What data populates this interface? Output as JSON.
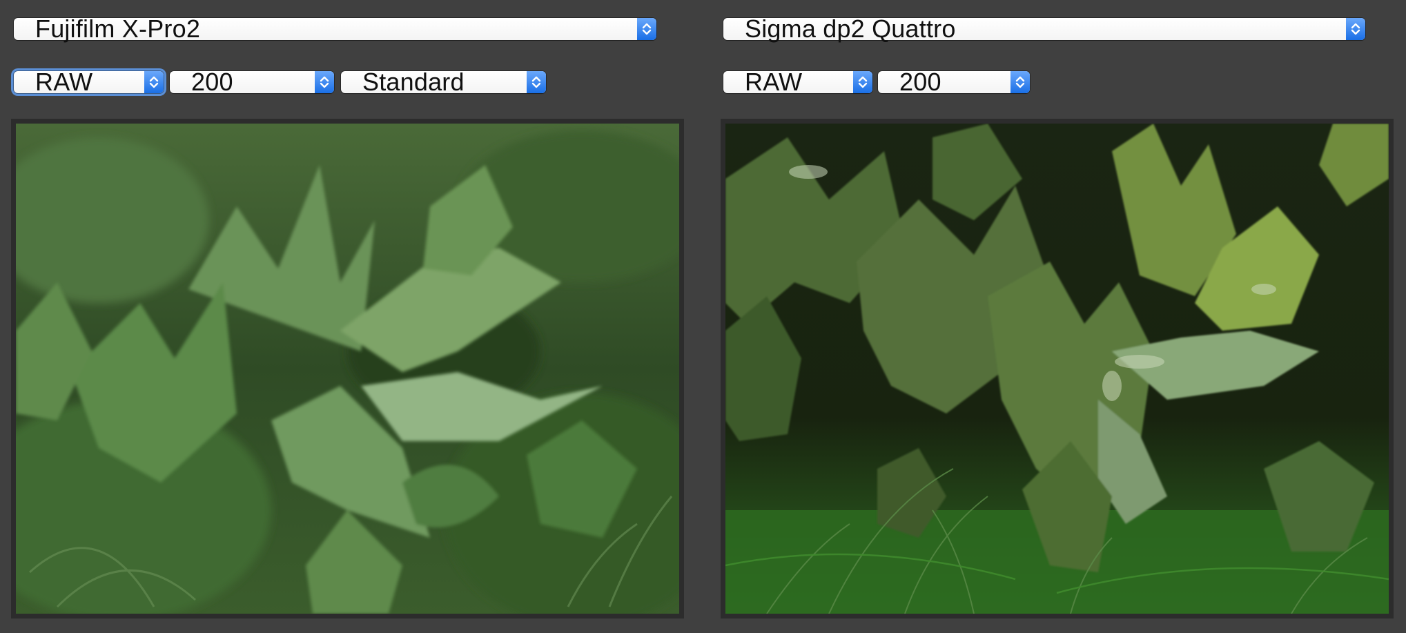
{
  "left_panel": {
    "camera": "Fujifilm X-Pro2",
    "format": "RAW",
    "iso": "200",
    "film_simulation": "Standard"
  },
  "right_panel": {
    "camera": "Sigma dp2 Quattro",
    "format": "RAW",
    "iso": "200"
  },
  "colors": {
    "background": "#404040",
    "stepper_accent": "#1a6fe6",
    "focus_ring": "#5b8fd6"
  },
  "icons": {
    "stepper": "chevron-up-down-icon"
  }
}
